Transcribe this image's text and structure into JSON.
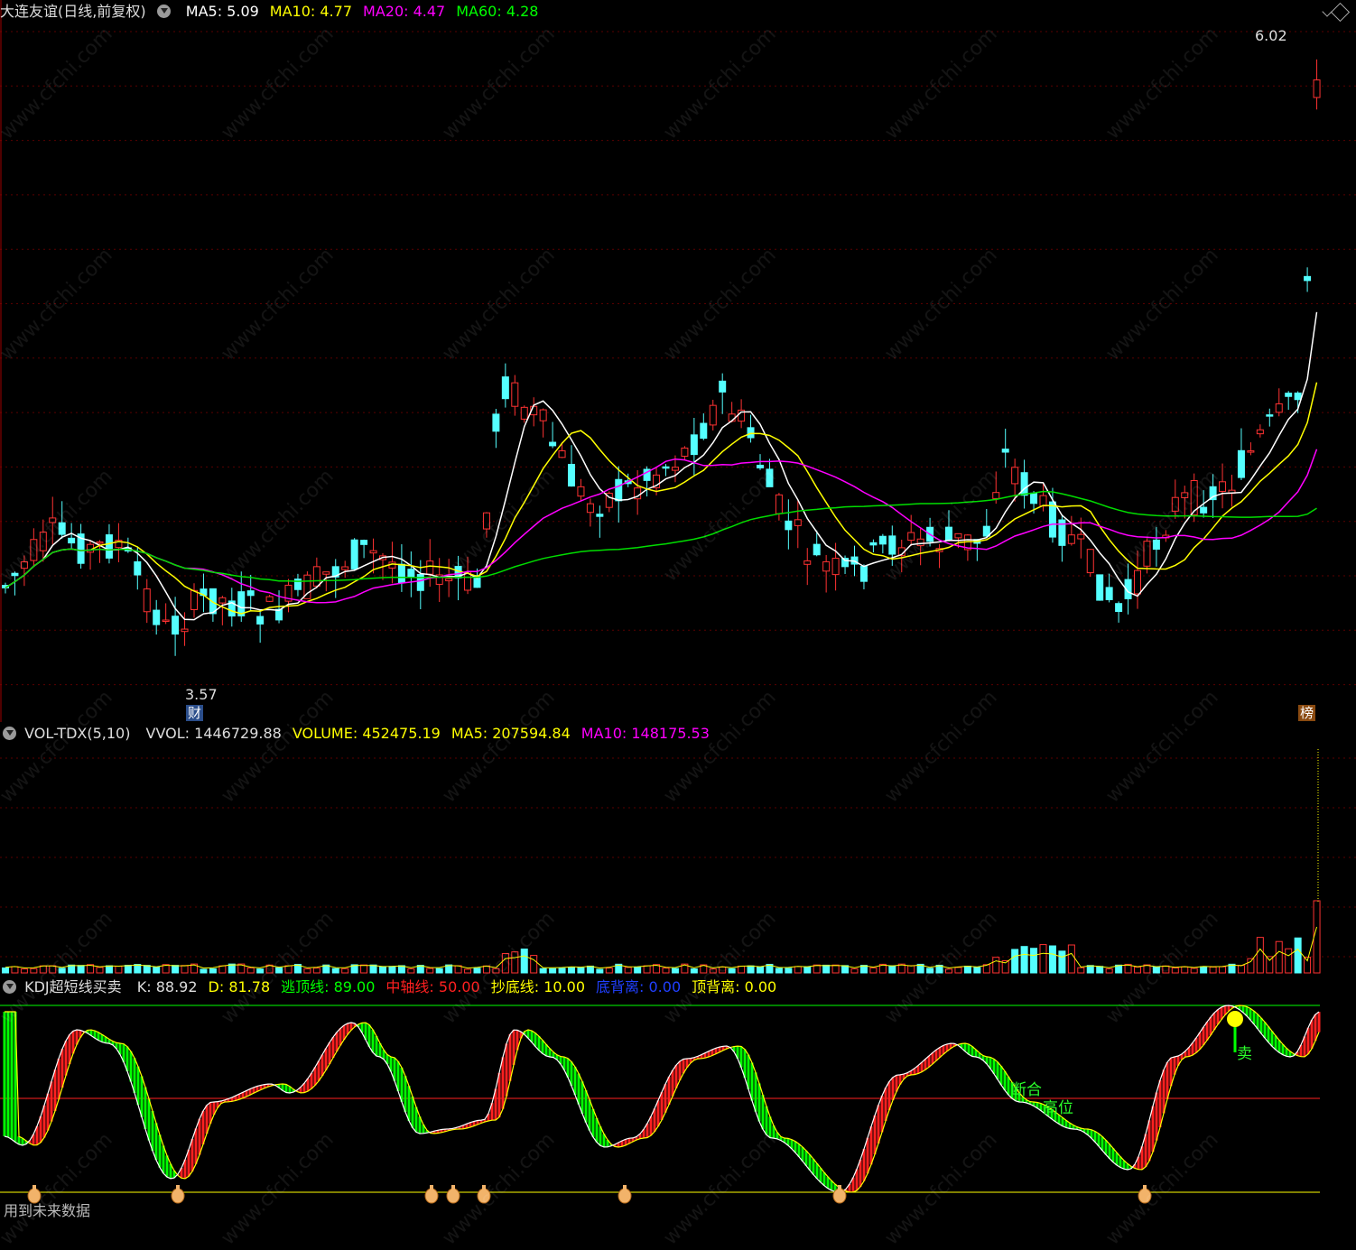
{
  "main": {
    "title": "大连友谊(日线,前复权)",
    "ma": [
      {
        "label": "MA5: 5.09",
        "color": "#ffffff"
      },
      {
        "label": "MA10: 4.77",
        "color": "#ffff00"
      },
      {
        "label": "MA20: 4.47",
        "color": "#ff00ff"
      },
      {
        "label": "MA60: 4.28",
        "color": "#00ff00"
      }
    ],
    "high_label": "6.02",
    "low_label": "3.57",
    "tag_cai": "财",
    "tag_bang": "榜"
  },
  "vol": {
    "title": "VOL-TDX(5,10)",
    "items": [
      {
        "label": "VVOL: 1446729.88",
        "color": "#dddddd"
      },
      {
        "label": "VOLUME: 452475.19",
        "color": "#ffff00"
      },
      {
        "label": "MA5: 207594.84",
        "color": "#ffff00"
      },
      {
        "label": "MA10: 148175.53",
        "color": "#ff00ff"
      }
    ]
  },
  "kdj": {
    "title": "KDJ超短线买卖",
    "items": [
      {
        "label": "K: 88.92",
        "color": "#dddddd"
      },
      {
        "label": "D: 81.78",
        "color": "#ffff00"
      },
      {
        "label": "逃顶线: 89.00",
        "color": "#00ff00"
      },
      {
        "label": "中轴线: 50.00",
        "color": "#ff2020"
      },
      {
        "label": "抄底线: 10.00",
        "color": "#ffff00"
      },
      {
        "label": "底背离: 0.00",
        "color": "#2040ff"
      },
      {
        "label": "顶背离: 0.00",
        "color": "#ffff00"
      }
    ],
    "annot_1": "断合",
    "annot_2": "高位",
    "sell": "卖",
    "footnote": "用到未来数据"
  },
  "watermark": "www.cfchi.com"
}
